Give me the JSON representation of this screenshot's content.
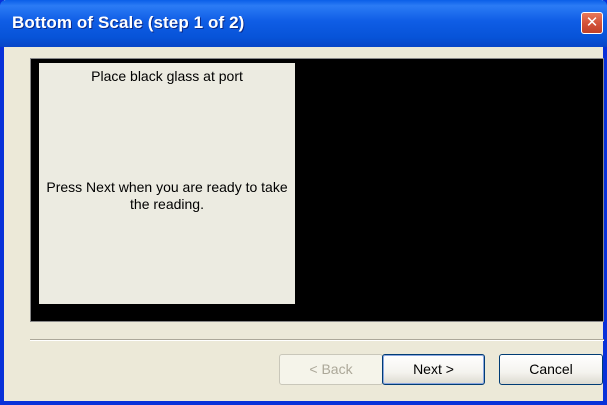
{
  "window": {
    "title": "Bottom of Scale (step 1 of 2)",
    "close_symbol": "✕"
  },
  "instructions": {
    "top": "Place black glass at port",
    "middle": "Press Next when you are ready to take the reading."
  },
  "buttons": {
    "back": "< Back",
    "next": "Next >",
    "cancel": "Cancel"
  },
  "colors": {
    "titlebar": "#0f5de5",
    "close_button": "#d4533a",
    "preview_area": "#000000",
    "dialog_background": "#ece9d8"
  }
}
